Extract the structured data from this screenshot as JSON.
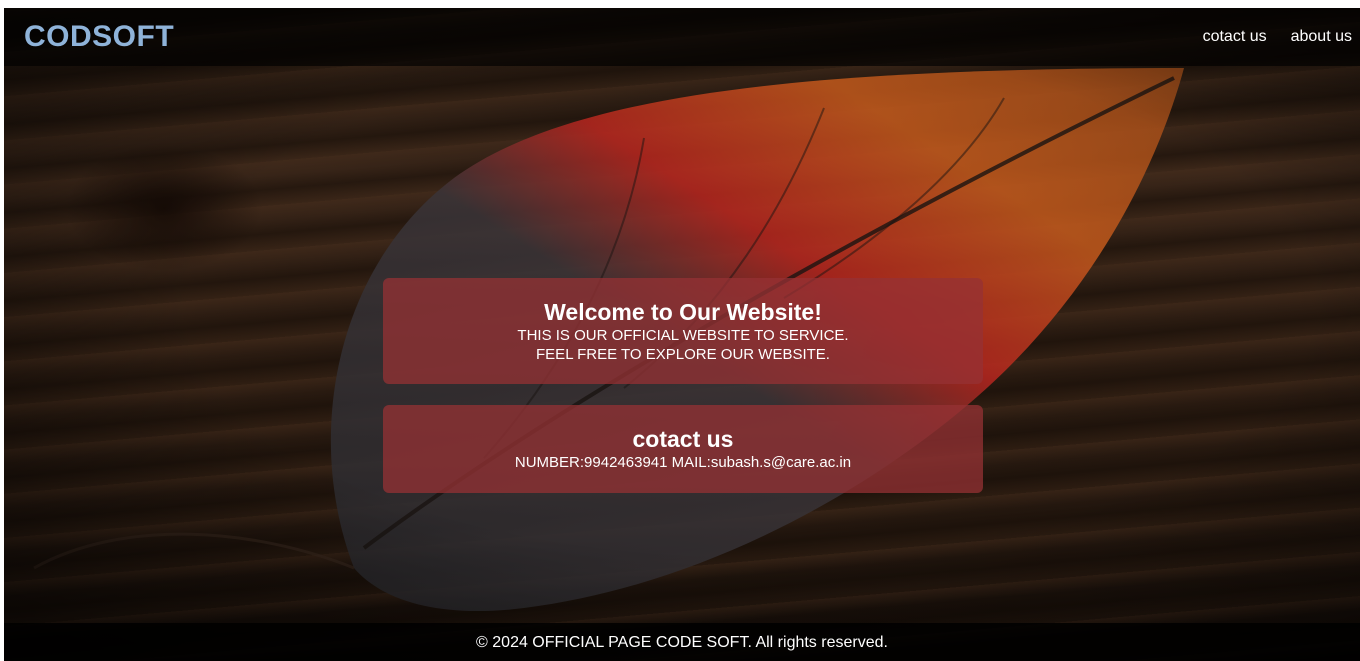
{
  "brand": {
    "logo": "CODSOFT",
    "logo_color": "#8fb3d9"
  },
  "nav": {
    "items": [
      {
        "label": "cotact us"
      },
      {
        "label": "about us"
      }
    ]
  },
  "welcome": {
    "title": "Welcome to Our Website!",
    "line1": "THIS IS OUR OFFICIAL WEBSITE TO SERVICE.",
    "line2": "FEEL FREE TO EXPLORE OUR WEBSITE."
  },
  "contact": {
    "title": "cotact us",
    "details": "NUMBER:9942463941 MAIL:subash.s@care.ac.in"
  },
  "footer": {
    "text": "© 2024 OFFICIAL PAGE CODE SOFT. All rights reserved."
  },
  "colors": {
    "card": "#963234",
    "navbar": "#000000",
    "text": "#ffffff"
  }
}
